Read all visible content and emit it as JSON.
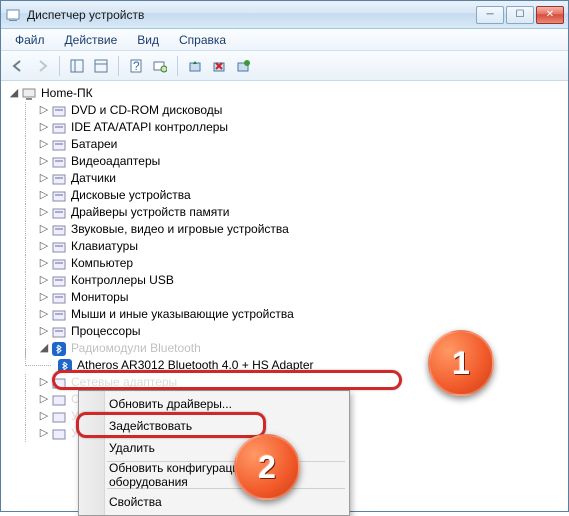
{
  "window": {
    "title": "Диспетчер устройств"
  },
  "menu": {
    "file": "Файл",
    "action": "Действие",
    "view": "Вид",
    "help": "Справка"
  },
  "tree": {
    "root": "Home-ПК",
    "items": [
      "DVD и CD-ROM дисководы",
      "IDE ATA/ATAPI контроллеры",
      "Батареи",
      "Видеоадаптеры",
      "Датчики",
      "Дисковые устройства",
      "Драйверы устройств памяти",
      "Звуковые, видео и игровые устройства",
      "Клавиатуры",
      "Компьютер",
      "Контроллеры USB",
      "Мониторы",
      "Мыши и иные указывающие устройства",
      "Процессоры"
    ],
    "bt_category": "Радиомодули Bluetooth",
    "bt_device": "Atheros AR3012 Bluetooth 4.0 + HS Adapter"
  },
  "context": {
    "update": "Обновить драйверы...",
    "enable": "Задействовать",
    "delete": "Удалить",
    "refresh": "Обновить конфигурацию оборудования",
    "properties": "Свойства"
  },
  "badges": {
    "one": "1",
    "two": "2"
  }
}
